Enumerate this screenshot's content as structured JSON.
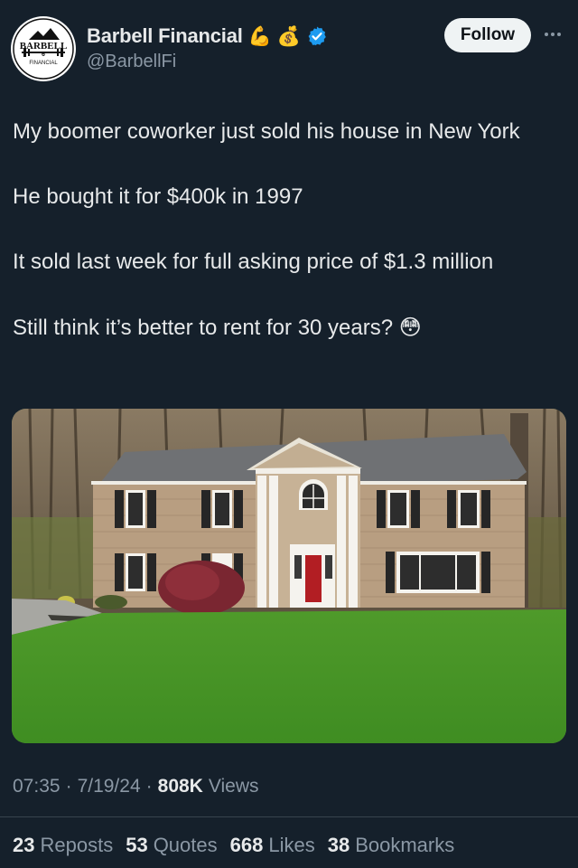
{
  "author": {
    "display_name": "Barbell Financial",
    "name_emojis": [
      "💪",
      "💰"
    ],
    "handle": "@BarbellFi",
    "verified": true,
    "avatar_text_top": "BARBELL",
    "avatar_text_bottom": "FINANCIAL"
  },
  "actions": {
    "follow_label": "Follow"
  },
  "tweet": {
    "paragraphs": [
      "My boomer coworker just sold his house in New York",
      "He bought it for $400k in 1997",
      "It sold last week for full asking price of $1.3 million",
      "Still think it’s better to rent for 30 years?"
    ],
    "trailing_emoji": "😳",
    "image_alt": "Two-story colonial house with a red front door and a green lawn"
  },
  "meta": {
    "time": "07:35",
    "date": "7/19/24",
    "views_count": "808K",
    "views_label": "Views",
    "separator": "·"
  },
  "stats": {
    "reposts": {
      "count": "23",
      "label": "Reposts"
    },
    "quotes": {
      "count": "53",
      "label": "Quotes"
    },
    "likes": {
      "count": "668",
      "label": "Likes"
    },
    "bookmarks": {
      "count": "38",
      "label": "Bookmarks"
    }
  },
  "colors": {
    "background": "#15202b",
    "text": "#e7e9ea",
    "secondary_text": "#8b98a5",
    "verified_blue": "#1d9bf0",
    "follow_bg": "#eff3f4"
  }
}
